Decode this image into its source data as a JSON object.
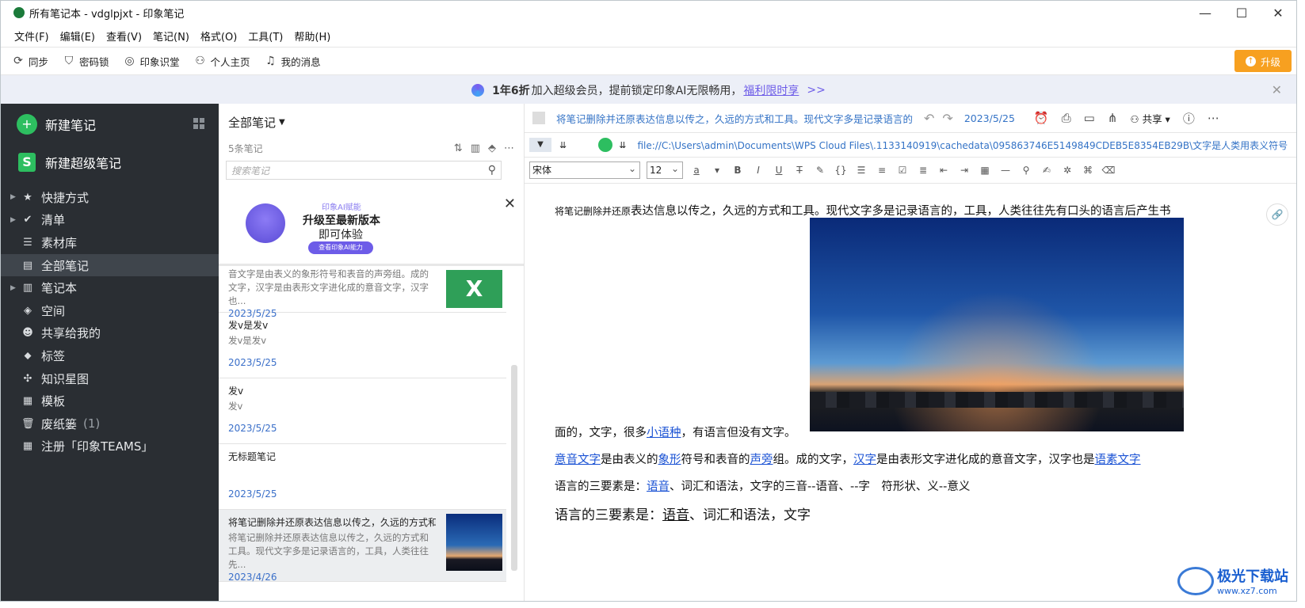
{
  "window": {
    "title": "所有笔记本 - vdglpjxt - 印象笔记",
    "controls": [
      "—",
      "☐",
      "✕"
    ]
  },
  "menu": [
    "文件(F)",
    "编辑(E)",
    "查看(V)",
    "笔记(N)",
    "格式(O)",
    "工具(T)",
    "帮助(H)"
  ],
  "toolbar": {
    "items": [
      {
        "label": "同步",
        "icon": "sync-icon"
      },
      {
        "label": "密码锁",
        "icon": "shield-icon"
      },
      {
        "label": "印象识堂",
        "icon": "target-icon"
      },
      {
        "label": "个人主页",
        "icon": "user-icon"
      },
      {
        "label": "我的消息",
        "icon": "bell-icon"
      }
    ],
    "upgrade_label": "升级"
  },
  "banner": {
    "bold": "1年6折",
    "text": "加入超级会员，提前锁定印象AI无限畅用，",
    "link": "福利限时享",
    "arrows": ">>"
  },
  "sidebar": {
    "new_note": "新建笔记",
    "new_super_note": "新建超级笔记",
    "items": [
      {
        "label": "快捷方式",
        "caret": true,
        "icon": "star-icon"
      },
      {
        "label": "清单",
        "caret": true,
        "icon": "check-circle-icon"
      },
      {
        "label": "素材库",
        "caret": false,
        "icon": "stack-icon"
      },
      {
        "label": "全部笔记",
        "caret": false,
        "icon": "note-icon",
        "active": true
      },
      {
        "label": "笔记本",
        "caret": true,
        "icon": "notebook-icon"
      },
      {
        "label": "空间",
        "caret": false,
        "icon": "cube-icon"
      },
      {
        "label": "共享给我的",
        "caret": false,
        "icon": "people-icon"
      },
      {
        "label": "标签",
        "caret": false,
        "icon": "tag-icon"
      },
      {
        "label": "知识星图",
        "caret": false,
        "icon": "graph-icon"
      },
      {
        "label": "模板",
        "caret": false,
        "icon": "template-icon"
      },
      {
        "label": "废纸篓",
        "caret": false,
        "icon": "trash-icon",
        "count": "(1)"
      },
      {
        "label": "注册「印象TEAMS」",
        "caret": false,
        "icon": "building-icon"
      }
    ]
  },
  "notelist": {
    "header": "全部笔记",
    "count": "5条笔记",
    "search_placeholder": "搜索笔记",
    "ad": {
      "kicker": "印象AI赋能",
      "line1": "升级至最新版本",
      "line2": "即可体验",
      "button": "查看印象AI能力"
    },
    "notes": [
      {
        "title": "",
        "body": "音文字是由表义的象形符号和表音的声旁组。成的文字，汉字是由表形文字进化成的意音文字，汉字也...",
        "date": "2023/5/25",
        "thumb": "x"
      },
      {
        "title": "发v是发v",
        "body": "发v是发v",
        "date": "2023/5/25",
        "thumb": ""
      },
      {
        "title": "发v",
        "body": "发v",
        "date": "2023/5/25",
        "thumb": ""
      },
      {
        "title": "无标题笔记",
        "body": "",
        "date": "2023/5/25",
        "thumb": ""
      },
      {
        "title": "将笔记删除并还原表达信息以传之，久远的方式和...",
        "body": "将笔记删除并还原表达信息以传之，久远的方式和工具。现代文字多是记录语言的，工具，人类往往先...",
        "date": "2023/4/26",
        "thumb": "photo"
      }
    ]
  },
  "editor": {
    "title": "将笔记删除并还原表达信息以传之，久远的方式和工具。现代文字多是记录语言的",
    "date": "2023/5/25",
    "share_label": "共享",
    "path": "file://C:\\Users\\admin\\Documents\\WPS Cloud Files\\.1133140919\\cachedata\\095863746E5149849CDEB5E8354EB29B\\文字是人类用表义符号",
    "font": "宋体",
    "size": "12",
    "content": {
      "p1_small": "将笔记删除并还原",
      "p1": "表达信息以传之，久远的方式和工具。现代文字多是记录语言的，工具，人类往往先有口头的语言后产生书",
      "p2_a": "面的，文字，很多",
      "p2_link": "小语种",
      "p2_b": "，有语言但没有文字。",
      "p3_l1": "意音文字",
      "p3_a": "是由表义的",
      "p3_l2": "象形",
      "p3_b": "符号和表音的",
      "p3_l3": "声旁",
      "p3_c": "组。成的文字，",
      "p3_l4": "汉字",
      "p3_d": "是由表形文字进化成的意音文字，汉字也是",
      "p3_l5": "语素文字",
      "p4_a": "语言的三要素是：",
      "p4_link": "语音",
      "p4_b": "、词汇和语法，文字的三音--语音、--字　符形状、义--意义",
      "p5_a": "语言的三要素是：",
      "p5_link": "语音",
      "p5_b": "、词汇和语法，文字"
    }
  },
  "watermark": {
    "text": "极光下载站",
    "sub": "www.xz7.com"
  }
}
